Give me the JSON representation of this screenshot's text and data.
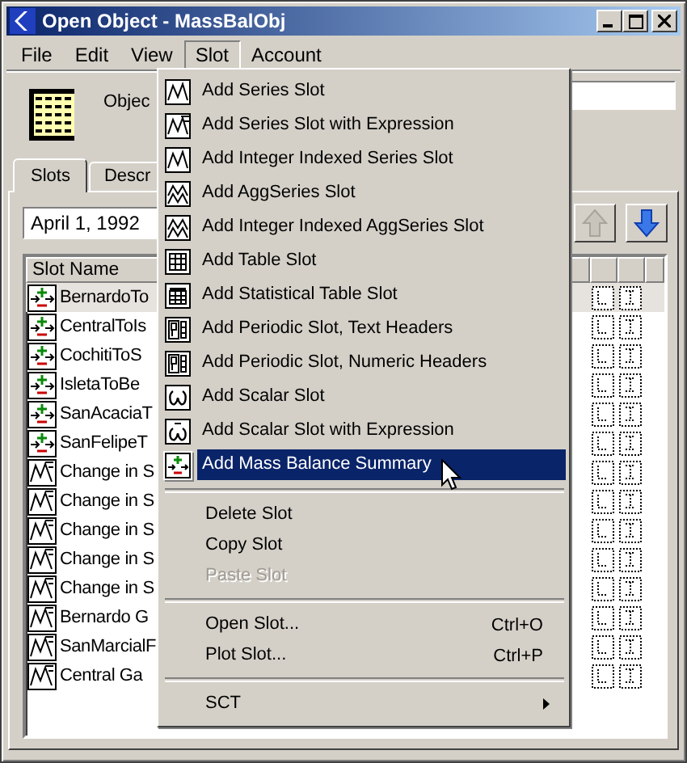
{
  "window": {
    "title": "Open Object - MassBalObj"
  },
  "menubar": [
    {
      "label": "File",
      "selected": false
    },
    {
      "label": "Edit",
      "selected": false
    },
    {
      "label": "View",
      "selected": false
    },
    {
      "label": "Slot",
      "selected": true
    },
    {
      "label": "Account",
      "selected": false
    }
  ],
  "object": {
    "label": "Objec"
  },
  "tabs": [
    {
      "label": "Slots",
      "selected": true
    },
    {
      "label": "Descr",
      "selected": false
    }
  ],
  "date": {
    "value": "April 1, 1992"
  },
  "nav_buttons": [
    {
      "kind": "up",
      "disabled": true
    },
    {
      "kind": "down",
      "disabled": false
    }
  ],
  "table": {
    "columns": [
      "Slot Name"
    ],
    "rows": [
      {
        "kind": "mass_balance",
        "name": "BernardoTo",
        "selected": true
      },
      {
        "kind": "mass_balance",
        "name": "CentralToIs",
        "selected": false
      },
      {
        "kind": "mass_balance",
        "name": "CochitiToS",
        "selected": false
      },
      {
        "kind": "mass_balance",
        "name": "IsletaToBe",
        "selected": false
      },
      {
        "kind": "mass_balance",
        "name": "SanAcaciaT",
        "selected": false
      },
      {
        "kind": "mass_balance",
        "name": "SanFelipeT",
        "selected": false
      },
      {
        "kind": "series_expr",
        "name": "Change in S",
        "selected": false
      },
      {
        "kind": "series_expr",
        "name": "Change in S",
        "selected": false
      },
      {
        "kind": "series_expr",
        "name": "Change in S",
        "selected": false
      },
      {
        "kind": "series_expr",
        "name": "Change in S",
        "selected": false
      },
      {
        "kind": "series_expr",
        "name": "Change in S",
        "selected": false
      },
      {
        "kind": "series_expr",
        "name": "Bernardo G",
        "selected": false
      },
      {
        "kind": "series_expr",
        "name": "SanMarcialF",
        "selected": false
      },
      {
        "kind": "series_expr",
        "name": "Central Ga",
        "selected": false
      }
    ]
  },
  "menu": {
    "items": [
      {
        "kind": "series",
        "label": "Add Series Slot",
        "selected": false,
        "disabled": false
      },
      {
        "kind": "series_expr",
        "label": "Add Series Slot with Expression",
        "selected": false,
        "disabled": false
      },
      {
        "kind": "series",
        "label": "Add Integer Indexed Series Slot",
        "selected": false,
        "disabled": false
      },
      {
        "kind": "agg",
        "label": "Add AggSeries Slot",
        "selected": false,
        "disabled": false
      },
      {
        "kind": "agg",
        "label": "Add Integer Indexed AggSeries Slot",
        "selected": false,
        "disabled": false
      },
      {
        "kind": "table",
        "label": "Add Table Slot",
        "selected": false,
        "disabled": false
      },
      {
        "kind": "stat_table",
        "label": "Add Statistical Table Slot",
        "selected": false,
        "disabled": false
      },
      {
        "kind": "periodic",
        "label": "Add Periodic Slot, Text Headers",
        "selected": false,
        "disabled": false
      },
      {
        "kind": "periodic",
        "label": "Add Periodic Slot, Numeric Headers",
        "selected": false,
        "disabled": false
      },
      {
        "kind": "scalar",
        "label": "Add Scalar Slot",
        "selected": false,
        "disabled": false
      },
      {
        "kind": "scalar_expr",
        "label": "Add Scalar Slot with Expression",
        "selected": false,
        "disabled": false
      },
      {
        "kind": "mass_balance",
        "label": "Add Mass Balance Summary",
        "selected": true,
        "disabled": false
      },
      {
        "kind": "separator"
      },
      {
        "kind": "plain",
        "label": "Delete Slot",
        "selected": false,
        "disabled": false
      },
      {
        "kind": "plain",
        "label": "Copy Slot",
        "selected": false,
        "disabled": false
      },
      {
        "kind": "plain",
        "label": "Paste Slot",
        "selected": false,
        "disabled": true
      },
      {
        "kind": "separator"
      },
      {
        "kind": "plain",
        "label": "Open Slot...",
        "shortcut": "Ctrl+O",
        "selected": false,
        "disabled": false
      },
      {
        "kind": "plain",
        "label": "Plot Slot...",
        "shortcut": "Ctrl+P",
        "selected": false,
        "disabled": false
      },
      {
        "kind": "separator"
      },
      {
        "kind": "submenu",
        "label": "SCT",
        "selected": false,
        "disabled": false
      }
    ]
  }
}
